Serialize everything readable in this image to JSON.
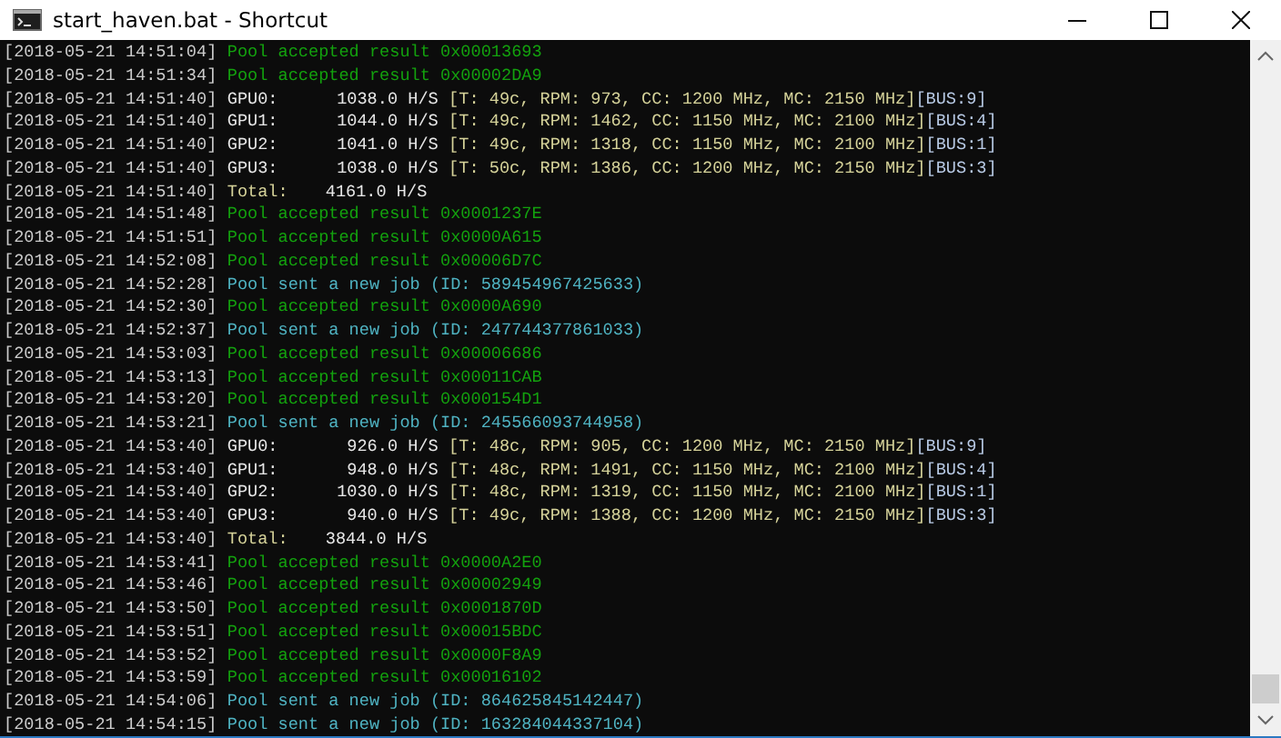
{
  "window": {
    "title": "start_haven.bat - Shortcut"
  },
  "console": {
    "lines": [
      {
        "kind": "accepted",
        "time": "[2018-05-21 14:51:04]",
        "text": "Pool accepted result 0x00013693"
      },
      {
        "kind": "accepted",
        "time": "[2018-05-21 14:51:34]",
        "text": "Pool accepted result 0x00002DA9"
      },
      {
        "kind": "gpu",
        "time": "[2018-05-21 14:51:40]",
        "label": "GPU0:",
        "rate": "1038.0 H/S",
        "stats": "[T: 49c, RPM: 973, CC: 1200 MHz, MC: 2150 MHz]",
        "bus": "[BUS:9]"
      },
      {
        "kind": "gpu",
        "time": "[2018-05-21 14:51:40]",
        "label": "GPU1:",
        "rate": "1044.0 H/S",
        "stats": "[T: 49c, RPM: 1462, CC: 1150 MHz, MC: 2100 MHz]",
        "bus": "[BUS:4]"
      },
      {
        "kind": "gpu",
        "time": "[2018-05-21 14:51:40]",
        "label": "GPU2:",
        "rate": "1041.0 H/S",
        "stats": "[T: 49c, RPM: 1318, CC: 1150 MHz, MC: 2100 MHz]",
        "bus": "[BUS:1]"
      },
      {
        "kind": "gpu",
        "time": "[2018-05-21 14:51:40]",
        "label": "GPU3:",
        "rate": "1038.0 H/S",
        "stats": "[T: 50c, RPM: 1386, CC: 1200 MHz, MC: 2150 MHz]",
        "bus": "[BUS:3]"
      },
      {
        "kind": "total",
        "time": "[2018-05-21 14:51:40]",
        "label": "Total:",
        "rate": "4161.0 H/S"
      },
      {
        "kind": "accepted",
        "time": "[2018-05-21 14:51:48]",
        "text": "Pool accepted result 0x0001237E"
      },
      {
        "kind": "accepted",
        "time": "[2018-05-21 14:51:51]",
        "text": "Pool accepted result 0x0000A615"
      },
      {
        "kind": "accepted",
        "time": "[2018-05-21 14:52:08]",
        "text": "Pool accepted result 0x00006D7C"
      },
      {
        "kind": "job",
        "time": "[2018-05-21 14:52:28]",
        "text": "Pool sent a new job (ID: 589454967425633)"
      },
      {
        "kind": "accepted",
        "time": "[2018-05-21 14:52:30]",
        "text": "Pool accepted result 0x0000A690"
      },
      {
        "kind": "job",
        "time": "[2018-05-21 14:52:37]",
        "text": "Pool sent a new job (ID: 247744377861033)"
      },
      {
        "kind": "accepted",
        "time": "[2018-05-21 14:53:03]",
        "text": "Pool accepted result 0x00006686"
      },
      {
        "kind": "accepted",
        "time": "[2018-05-21 14:53:13]",
        "text": "Pool accepted result 0x00011CAB"
      },
      {
        "kind": "accepted",
        "time": "[2018-05-21 14:53:20]",
        "text": "Pool accepted result 0x000154D1"
      },
      {
        "kind": "job",
        "time": "[2018-05-21 14:53:21]",
        "text": "Pool sent a new job (ID: 245566093744958)"
      },
      {
        "kind": "gpu",
        "time": "[2018-05-21 14:53:40]",
        "label": "GPU0:",
        "rate": "926.0 H/S",
        "stats": "[T: 48c, RPM: 905, CC: 1200 MHz, MC: 2150 MHz]",
        "bus": "[BUS:9]"
      },
      {
        "kind": "gpu",
        "time": "[2018-05-21 14:53:40]",
        "label": "GPU1:",
        "rate": "948.0 H/S",
        "stats": "[T: 48c, RPM: 1491, CC: 1150 MHz, MC: 2100 MHz]",
        "bus": "[BUS:4]"
      },
      {
        "kind": "gpu",
        "time": "[2018-05-21 14:53:40]",
        "label": "GPU2:",
        "rate": "1030.0 H/S",
        "stats": "[T: 48c, RPM: 1319, CC: 1150 MHz, MC: 2100 MHz]",
        "bus": "[BUS:1]"
      },
      {
        "kind": "gpu",
        "time": "[2018-05-21 14:53:40]",
        "label": "GPU3:",
        "rate": "940.0 H/S",
        "stats": "[T: 49c, RPM: 1388, CC: 1200 MHz, MC: 2150 MHz]",
        "bus": "[BUS:3]"
      },
      {
        "kind": "total",
        "time": "[2018-05-21 14:53:40]",
        "label": "Total:",
        "rate": "3844.0 H/S"
      },
      {
        "kind": "accepted",
        "time": "[2018-05-21 14:53:41]",
        "text": "Pool accepted result 0x0000A2E0"
      },
      {
        "kind": "accepted",
        "time": "[2018-05-21 14:53:46]",
        "text": "Pool accepted result 0x00002949"
      },
      {
        "kind": "accepted",
        "time": "[2018-05-21 14:53:50]",
        "text": "Pool accepted result 0x0001870D"
      },
      {
        "kind": "accepted",
        "time": "[2018-05-21 14:53:51]",
        "text": "Pool accepted result 0x00015BDC"
      },
      {
        "kind": "accepted",
        "time": "[2018-05-21 14:53:52]",
        "text": "Pool accepted result 0x0000F8A9"
      },
      {
        "kind": "accepted",
        "time": "[2018-05-21 14:53:59]",
        "text": "Pool accepted result 0x00016102"
      },
      {
        "kind": "job",
        "time": "[2018-05-21 14:54:06]",
        "text": "Pool sent a new job (ID: 864625845142447)"
      },
      {
        "kind": "job",
        "time": "[2018-05-21 14:54:15]",
        "text": "Pool sent a new job (ID: 163284044337104)"
      }
    ]
  }
}
